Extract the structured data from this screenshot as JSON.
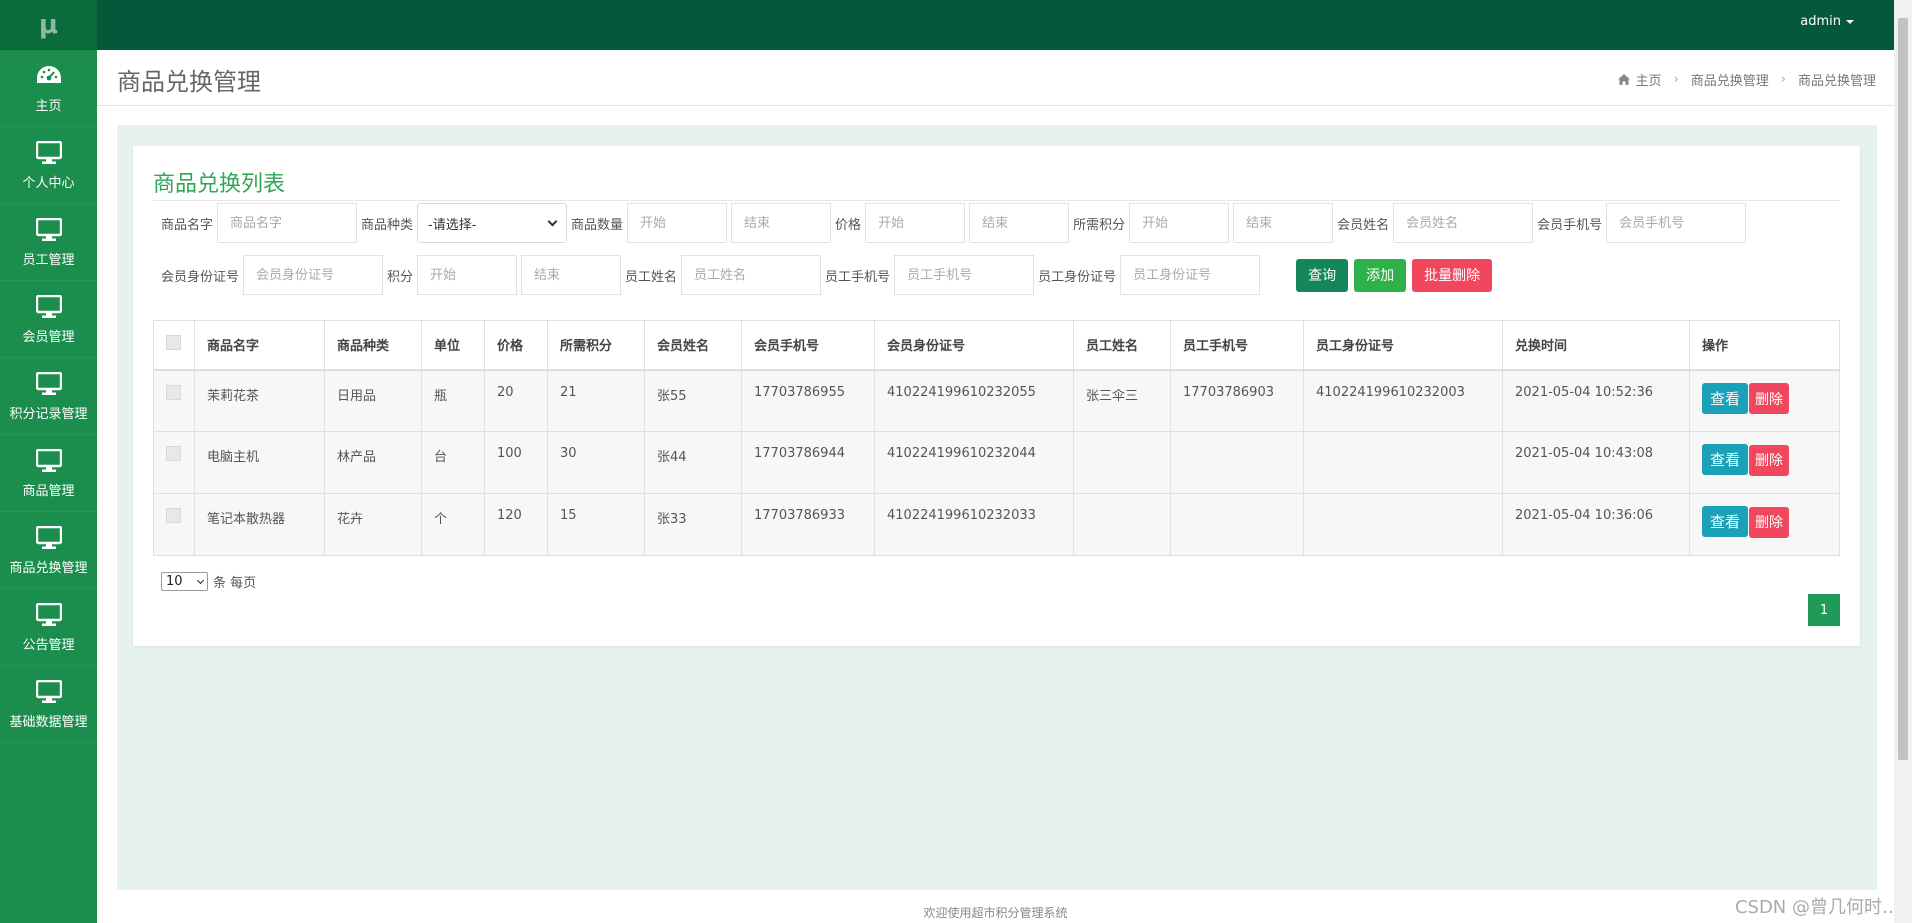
{
  "app": {
    "brand": "μ"
  },
  "topbar": {
    "user": "admin"
  },
  "sidebar": {
    "items": [
      {
        "label": "主页",
        "icon": "dashboard-icon"
      },
      {
        "label": "个人中心",
        "icon": "monitor-icon"
      },
      {
        "label": "员工管理",
        "icon": "monitor-icon"
      },
      {
        "label": "会员管理",
        "icon": "monitor-icon"
      },
      {
        "label": "积分记录管理",
        "icon": "monitor-icon"
      },
      {
        "label": "商品管理",
        "icon": "monitor-icon"
      },
      {
        "label": "商品兑换管理",
        "icon": "monitor-icon"
      },
      {
        "label": "公告管理",
        "icon": "monitor-icon"
      },
      {
        "label": "基础数据管理",
        "icon": "monitor-icon"
      }
    ]
  },
  "header": {
    "title": "商品兑换管理",
    "breadcrumb": [
      "主页",
      "商品兑换管理",
      "商品兑换管理"
    ]
  },
  "card": {
    "title": "商品兑换列表"
  },
  "filters": {
    "product_name": {
      "label": "商品名字",
      "placeholder": "商品名字"
    },
    "product_type": {
      "label": "商品种类",
      "value": "-请选择-"
    },
    "quantity": {
      "label": "商品数量",
      "start": "开始",
      "end": "结束"
    },
    "price": {
      "label": "价格",
      "start": "开始",
      "end": "结束"
    },
    "points_needed": {
      "label": "所需积分",
      "start": "开始",
      "end": "结束"
    },
    "member_name": {
      "label": "会员姓名",
      "placeholder": "会员姓名"
    },
    "member_phone": {
      "label": "会员手机号",
      "placeholder": "会员手机号"
    },
    "member_id": {
      "label": "会员身份证号",
      "placeholder": "会员身份证号"
    },
    "points": {
      "label": "积分",
      "start": "开始",
      "end": "结束"
    },
    "staff_name": {
      "label": "员工姓名",
      "placeholder": "员工姓名"
    },
    "staff_phone": {
      "label": "员工手机号",
      "placeholder": "员工手机号"
    },
    "staff_id": {
      "label": "员工身份证号",
      "placeholder": "员工身份证号"
    },
    "buttons": {
      "query": "查询",
      "add": "添加",
      "batch_delete": "批量删除"
    }
  },
  "table": {
    "headers": [
      "商品名字",
      "商品种类",
      "单位",
      "价格",
      "所需积分",
      "会员姓名",
      "会员手机号",
      "会员身份证号",
      "员工姓名",
      "员工手机号",
      "员工身份证号",
      "兑换时间",
      "操作"
    ],
    "rows": [
      [
        "茉莉花茶",
        "日用品",
        "瓶",
        "20",
        "21",
        "张55",
        "17703786955",
        "410224199610232055",
        "张三伞三",
        "17703786903",
        "410224199610232003",
        "2021-05-04 10:52:36"
      ],
      [
        "电脑主机",
        "林产品",
        "台",
        "100",
        "30",
        "张44",
        "17703786944",
        "410224199610232044",
        "",
        "",
        "",
        "2021-05-04 10:43:08"
      ],
      [
        "笔记本散热器",
        "花卉",
        "个",
        "120",
        "15",
        "张33",
        "17703786933",
        "410224199610232033",
        "",
        "",
        "",
        "2021-05-04 10:36:06"
      ]
    ],
    "actions": {
      "view": "查看",
      "delete": "删除"
    }
  },
  "pager": {
    "page_size": "10",
    "per_page_text": "条 每页",
    "current_page": "1"
  },
  "footer": {
    "text": "欢迎使用超市积分管理系统"
  },
  "watermark": "CSDN @曾几何时…",
  "colors": {
    "sidebar": "#1b8d4c",
    "topbar": "#03593a",
    "accent": "#2ea857",
    "danger": "#f0475e",
    "info": "#1aa0b8"
  }
}
